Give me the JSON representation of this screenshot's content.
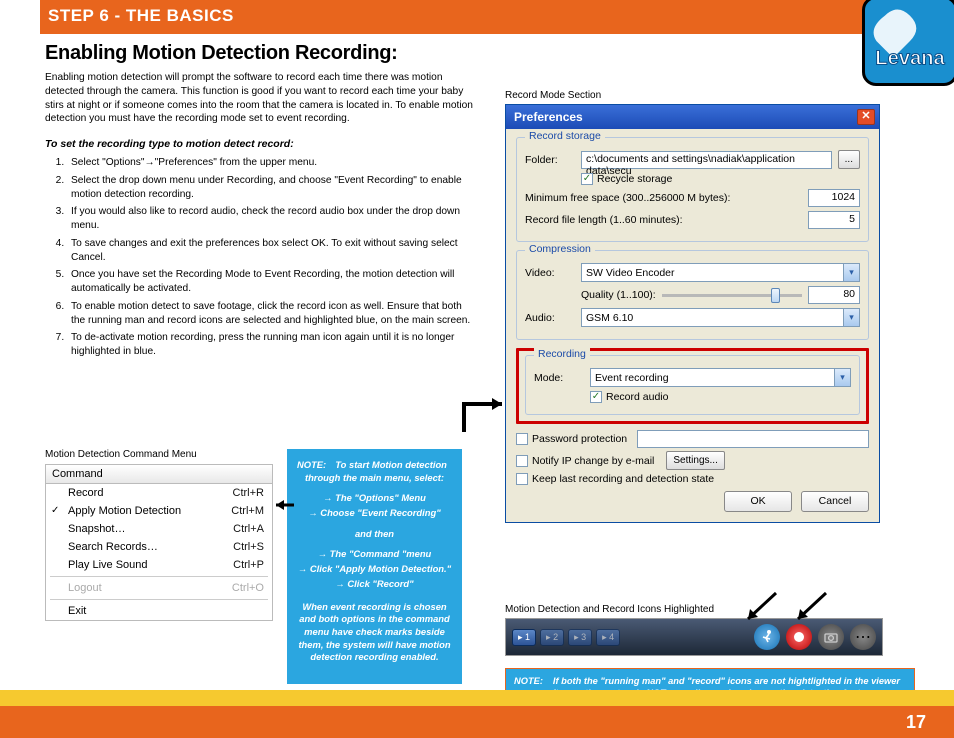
{
  "header": {
    "step_title": "STEP 6   - THE BASICS"
  },
  "logo": {
    "brand": "Levana"
  },
  "article": {
    "heading": "Enabling Motion Detection Recording:",
    "intro": "Enabling motion detection will prompt the software to record each time there was motion detected through the camera.  This function is good if you want to record each time your baby stirs at night or if someone comes into the room that the camera is located in. To enable motion detection you must have the recording mode set to event recording.",
    "subheading": "To set the recording type to motion detect record:",
    "steps": [
      "Select \"Options\"→\"Preferences\" from the upper menu.",
      "Select the drop down menu under Recording, and choose \"Event Recording\" to enable motion detection recording.",
      "If you would also like to record audio, check the record audio box under the drop down menu.",
      "To save changes and exit the preferences box select OK. To exit without saving select Cancel.",
      "Once you have set the Recording Mode to Event Recording, the motion detection will automatically be activated.",
      "To enable motion detect to save footage, click the record icon as well. Ensure that both the running man and record icons are selected and highlighted blue, on the main screen.",
      "To de-activate motion recording, press the running man icon again until it is no longer highlighted in blue."
    ]
  },
  "cmd": {
    "caption": "Motion Detection Command Menu",
    "header": "Command",
    "items": [
      {
        "label": "Record",
        "shortcut": "Ctrl+R",
        "checked": false
      },
      {
        "label": "Apply Motion Detection",
        "shortcut": "Ctrl+M",
        "checked": true
      },
      {
        "label": "Snapshot…",
        "shortcut": "Ctrl+A",
        "checked": false
      },
      {
        "label": "Search Records…",
        "shortcut": "Ctrl+S",
        "checked": false
      },
      {
        "label": "Play Live Sound",
        "shortcut": "Ctrl+P",
        "checked": false
      }
    ],
    "logout": {
      "label": "Logout",
      "shortcut": "Ctrl+O"
    },
    "exit": {
      "label": "Exit",
      "shortcut": ""
    }
  },
  "note1": {
    "label": "NOTE:",
    "l1": "To start Motion detection through the main menu, select:",
    "a1": "→  The \"Options\" Menu",
    "a2": "→  Choose \"Event Recording\"",
    "mid": "and then",
    "a3": "→  The \"Command \"menu",
    "a4": "→  Click \"Apply Motion Detection.\"",
    "a5": "→ Click \"Record\"",
    "l2": "When  event recording is chosen and both options in the command menu have check marks beside them,  the system will have motion detection recording enabled."
  },
  "pref": {
    "caption": "Record Mode Section",
    "title": "Preferences",
    "groups": {
      "storage": {
        "legend": "Record storage",
        "folder_lbl": "Folder:",
        "folder": "c:\\documents and settings\\nadiak\\application data\\secu",
        "browse": "...",
        "recycle": "Recycle storage",
        "minfree_lbl": "Minimum free space (300..256000 M bytes):",
        "minfree": "1024",
        "reclen_lbl": "Record file length (1..60 minutes):",
        "reclen": "5"
      },
      "compression": {
        "legend": "Compression",
        "video_lbl": "Video:",
        "video": "SW Video Encoder",
        "quality_lbl": "Quality (1..100):",
        "quality": "80",
        "audio_lbl": "Audio:",
        "audio": "GSM 6.10"
      },
      "recording": {
        "legend": "Recording",
        "mode_lbl": "Mode:",
        "mode": "Event recording",
        "record_audio": "Record audio"
      },
      "misc": {
        "pwd": "Password protection",
        "notify": "Notify IP change by e-mail",
        "settings": "Settings...",
        "keep": "Keep last recording and detection state"
      }
    },
    "ok": "OK",
    "cancel": "Cancel"
  },
  "iconbar": {
    "caption": "Motion Detection and Record Icons Highlighted",
    "tabs": [
      "1",
      "2",
      "3",
      "4"
    ]
  },
  "note2": {
    "label": "NOTE:",
    "text": "If both the \"running man\" and \"record\" icons are not hightlighted in the viewer software, the  system is NOT  recording and saving motion detection footage."
  },
  "footer": {
    "page": "17"
  }
}
